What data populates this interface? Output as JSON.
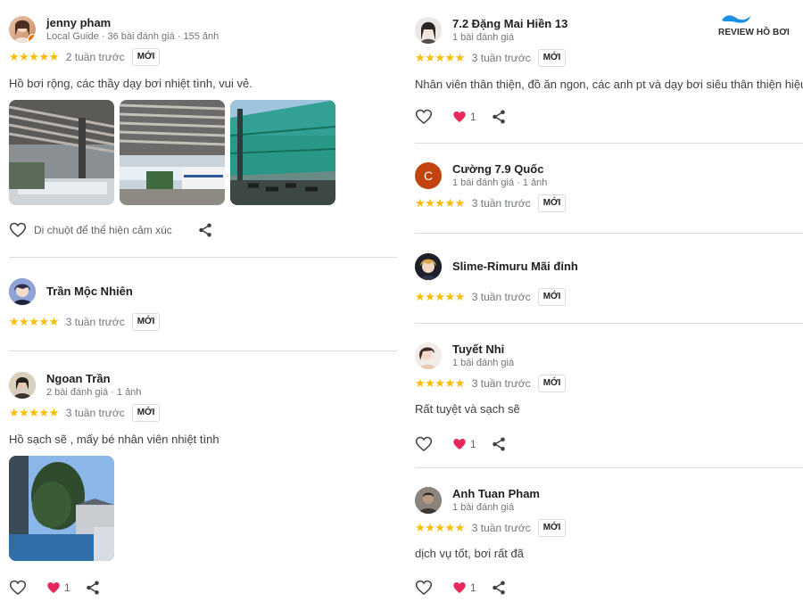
{
  "brand": {
    "label": "REVIEW HỒ BƠI"
  },
  "common": {
    "new_badge": "MỚI",
    "hover_hint": "Di chuột để thể hiện cảm xúc"
  },
  "left": [
    {
      "name": "jenny pham",
      "meta": "Local Guide · 36 bài đánh giá · 155 ảnh",
      "stars": "★★★★★",
      "time": "2 tuần trước",
      "text": "Hồ bơi rộng, các thầy dạy bơi nhiệt tình, vui vẻ."
    },
    {
      "name": "Trần Mộc Nhiên",
      "stars": "★★★★★",
      "time": "3 tuần trước"
    },
    {
      "name": "Ngoan Trần",
      "meta": "2 bài đánh giá · 1 ảnh",
      "stars": "★★★★★",
      "time": "3 tuần trước",
      "text": "Hồ sạch sẽ , mấy bé nhân viên nhiệt tình",
      "likes": "1"
    }
  ],
  "right": [
    {
      "name": "7.2 Đặng Mai Hiền 13",
      "meta": "1 bài đánh giá",
      "stars": "★★★★★",
      "time": "3 tuần trước",
      "text": "Nhân viên thân thiện, đồ ăn ngon, các anh pt và dạy bơi siêu thân thiện hiệu quả",
      "likes": "1"
    },
    {
      "name": "Cường 7.9 Quốc",
      "avatar_letter": "C",
      "meta": "1 bài đánh giá · 1 ảnh",
      "stars": "★★★★★",
      "time": "3 tuần trước"
    },
    {
      "name": "Slime-Rimuru Mãi đỉnh",
      "stars": "★★★★★",
      "time": "3 tuần trước"
    },
    {
      "name": "Tuyết Nhi",
      "meta": "1 bài đánh giá",
      "stars": "★★★★★",
      "time": "3 tuần trước",
      "text": "Rất tuyệt và sạch sẽ",
      "likes": "1"
    },
    {
      "name": "Anh Tuan Pham",
      "meta": "1 bài đánh giá",
      "stars": "★★★★★",
      "time": "3 tuần trước",
      "text": "dịch vụ tốt, bơi rất đã",
      "likes": "1"
    }
  ],
  "colors": {
    "star": "#fbbc04",
    "like_heart": "#e8275a",
    "avatar_letter_bg": "#c1440e",
    "badge_local_guide": "#e8710a",
    "brand_wave": "#1a8fe3"
  }
}
